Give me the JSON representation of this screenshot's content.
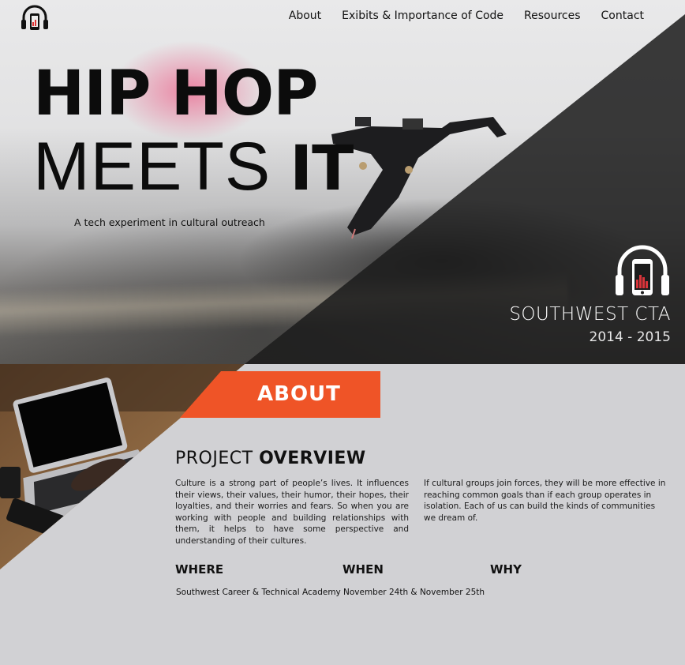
{
  "nav": {
    "items": [
      "About",
      "Exibits & Importance of Code",
      "Resources",
      "Contact"
    ]
  },
  "logo_icon": "headphones-phone-icon",
  "hero": {
    "title_line1": "HIP HOP",
    "title_line2_light": "MEETS",
    "title_line2_bold": "IT",
    "tagline": "A tech experiment in cultural outreach",
    "school": "SOUTHWEST CTA",
    "years": "2014 - 2015"
  },
  "about": {
    "banner_label": "ABOUT",
    "heading_light": "PROJECT",
    "heading_bold": "OVERVIEW",
    "paragraph1": "Culture is a strong part of people’s lives. It influences their views, their values, their humor, their hopes, their loyalties, and their worries and fears. So when you are working with people and building relationships with them, it helps to have some perspective and understanding of their cultures.",
    "paragraph2": "If cultural groups join forces, they will be more effective in reaching common goals than if each group operates in isolation. Each of us can build the kinds of communities we dream of.",
    "where_label": "WHERE",
    "where_value": "Southwest Career & Technical Academy",
    "when_label": "WHEN",
    "when_value": "November 24th & November 25th",
    "why_label": "WHY"
  },
  "colors": {
    "accent": "#ef5427",
    "about_background": "#d1d1d4",
    "dark_overlay": "#1c1c1c"
  }
}
